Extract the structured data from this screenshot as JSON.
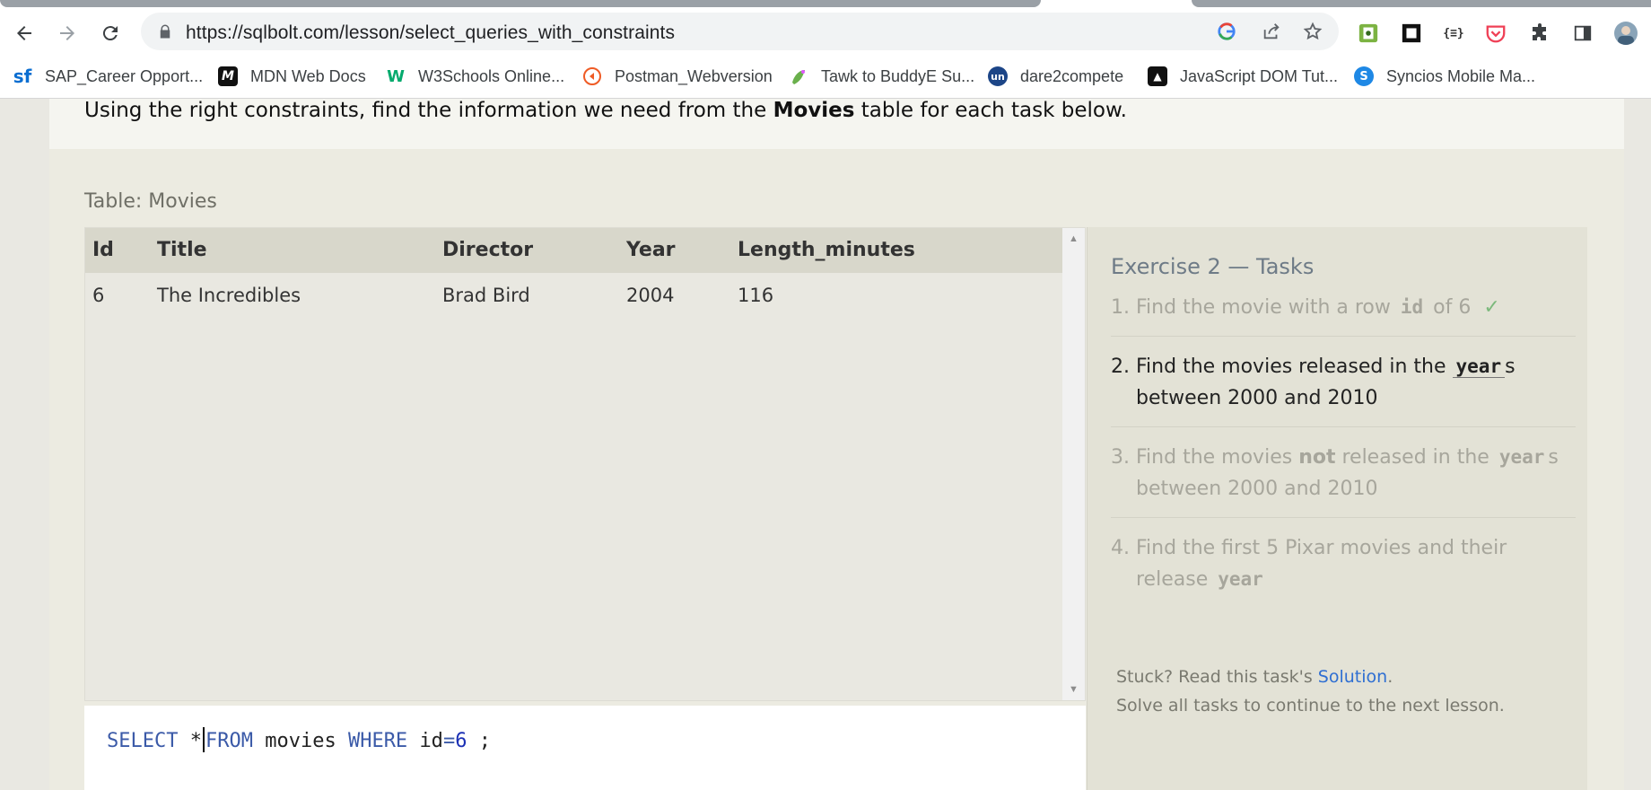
{
  "browser": {
    "url": "https://sqlbolt.com/lesson/select_queries_with_constraints",
    "bookmarks": [
      {
        "label": "SAP_Career Opport...",
        "icon": "sf"
      },
      {
        "label": "MDN Web Docs",
        "icon": "M"
      },
      {
        "label": "W3Schools Online...",
        "icon": "W"
      },
      {
        "label": "Postman_Webversion",
        "icon": "postman"
      },
      {
        "label": "Tawk to BuddyE Su...",
        "icon": "tawk"
      },
      {
        "label": "dare2compete",
        "icon": "un"
      },
      {
        "label": "JavaScript DOM Tut...",
        "icon": "js"
      },
      {
        "label": "Syncios Mobile Ma...",
        "icon": "syncios"
      }
    ]
  },
  "lesson": {
    "intro_before": "Using the right constraints, find the information we need from the ",
    "intro_bold": "Movies",
    "intro_after": " table for each task below.",
    "table_caption": "Table: Movies",
    "columns": [
      "Id",
      "Title",
      "Director",
      "Year",
      "Length_minutes"
    ],
    "rows": [
      [
        "6",
        "The Incredibles",
        "Brad Bird",
        "2004",
        "116"
      ]
    ],
    "query": {
      "kw_select": "SELECT",
      "star": "*",
      "kw_from": "FROM",
      "table": "movies",
      "kw_where": "WHERE",
      "column": "id",
      "eq": "=",
      "value": "6",
      "end": ";"
    }
  },
  "tasks": {
    "title": "Exercise 2 — Tasks",
    "items": [
      {
        "num": "1.",
        "pre": "Find the movie with a row ",
        "code": "id",
        "post": " of 6",
        "check": "✓",
        "state": "done"
      },
      {
        "num": "2.",
        "pre": "Find the movies released in the ",
        "code": "year",
        "post": "s between 2000 and 2010",
        "state": "active"
      },
      {
        "num": "3.",
        "pre": "Find the movies ",
        "bold": "not",
        "mid": " released in the ",
        "code": "year",
        "post": "s between 2000 and 2010",
        "state": "pending"
      },
      {
        "num": "4.",
        "pre": "Find the first 5 Pixar movies and their release ",
        "code": "year",
        "post": "",
        "state": "pending"
      }
    ],
    "stuck_text": "Stuck? Read this task's ",
    "solution_link": "Solution",
    "stuck_end": ".",
    "next_text": "Solve all tasks to continue to the next lesson."
  },
  "colors": {
    "accent_link": "#2f6fd2",
    "sql_keyword": "#3b5aa8",
    "check_green": "#7cb97c"
  }
}
